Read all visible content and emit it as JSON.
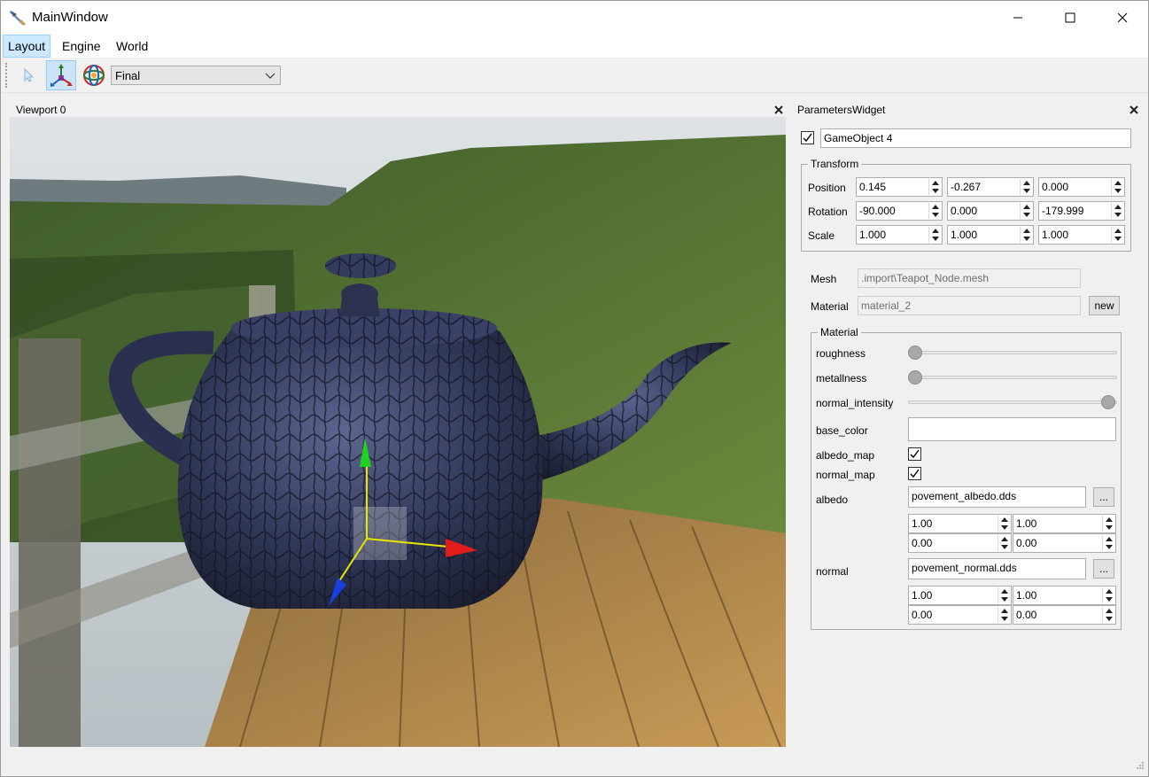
{
  "window": {
    "title": "MainWindow"
  },
  "menu": [
    "Layout",
    "Engine",
    "World"
  ],
  "toolbar": {
    "render_mode": "Final",
    "icons": [
      "select-arrow-icon",
      "move-gizmo-icon",
      "rotate-gizmo-icon"
    ]
  },
  "viewport": {
    "title": "Viewport 0"
  },
  "params": {
    "title": "ParametersWidget",
    "object_enabled": true,
    "object_name": "GameObject 4",
    "transform": {
      "title": "Transform",
      "rows": [
        {
          "label": "Position",
          "values": [
            "0.145",
            "-0.267",
            "0.000"
          ]
        },
        {
          "label": "Rotation",
          "values": [
            "-90.000",
            "0.000",
            "-179.999"
          ]
        },
        {
          "label": "Scale",
          "values": [
            "1.000",
            "1.000",
            "1.000"
          ]
        }
      ]
    },
    "mesh_label": "Mesh",
    "mesh_value": ".import\\Teapot_Node.mesh",
    "material_label": "Material",
    "material_value": "material_2",
    "new_button": "new",
    "material_group": {
      "title": "Material",
      "roughness_label": "roughness",
      "roughness": 0.0,
      "metallness_label": "metallness",
      "metallness": 0.0,
      "normal_intensity_label": "normal_intensity",
      "normal_intensity": 1.0,
      "base_color_label": "base_color",
      "base_color": "#ffffff",
      "albedo_map_label": "albedo_map",
      "albedo_map": true,
      "normal_map_label": "normal_map",
      "normal_map": true,
      "albedo_label": "albedo",
      "albedo_file": "povement_albedo.dds",
      "albedo_values": [
        "1.00",
        "1.00",
        "0.00",
        "0.00"
      ],
      "normal_label": "normal",
      "normal_file": "povement_normal.dds",
      "normal_values": [
        "1.00",
        "1.00",
        "0.00",
        "0.00"
      ],
      "browse_button": "..."
    }
  }
}
